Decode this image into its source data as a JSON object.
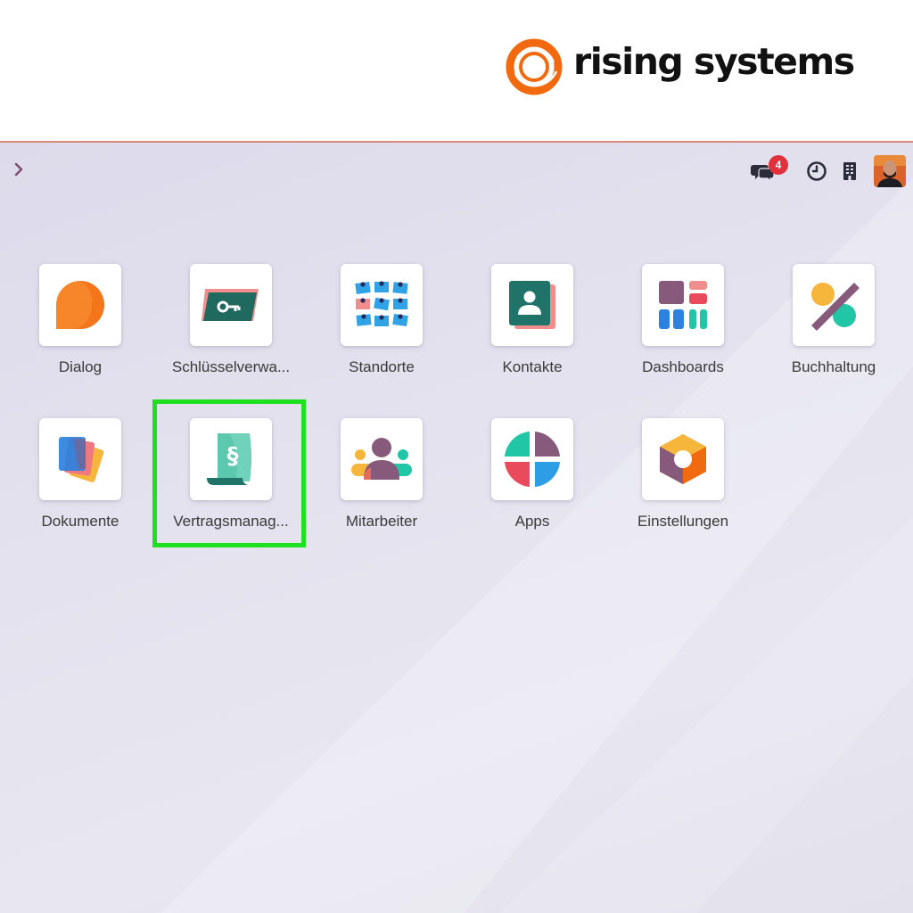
{
  "brand": {
    "name": "rising systems",
    "logo_icon": "ring-logo-icon",
    "color": "#f26a10"
  },
  "navbar": {
    "menu_toggle_icon": "chevron-right-icon",
    "messages_icon": "chat-bubbles-icon",
    "messages_badge": "4",
    "activities_icon": "clock-icon",
    "company_icon": "building-icon",
    "avatar_icon": "user-avatar"
  },
  "apps": [
    {
      "label": "Dialog",
      "icon": "dialog-icon"
    },
    {
      "label": "Schlüsselverwa...",
      "icon": "key-card-icon"
    },
    {
      "label": "Standorte",
      "icon": "locations-grid-icon"
    },
    {
      "label": "Kontakte",
      "icon": "contact-card-icon"
    },
    {
      "label": "Dashboards",
      "icon": "dashboard-tiles-icon"
    },
    {
      "label": "Buchhaltung",
      "icon": "percent-icon"
    },
    {
      "label": "Dokumente",
      "icon": "documents-stack-icon"
    },
    {
      "label": "Vertragsmanag...",
      "icon": "contract-scroll-icon"
    },
    {
      "label": "Mitarbeiter",
      "icon": "employees-icon"
    },
    {
      "label": "Apps",
      "icon": "apps-quad-icon"
    },
    {
      "label": "Einstellungen",
      "icon": "settings-hexagon-icon"
    }
  ],
  "highlighted_app": "Vertragsmanag...",
  "colors": {
    "highlight": "#1fe01f",
    "badge": "#e0313c",
    "accent": "#714b67"
  }
}
